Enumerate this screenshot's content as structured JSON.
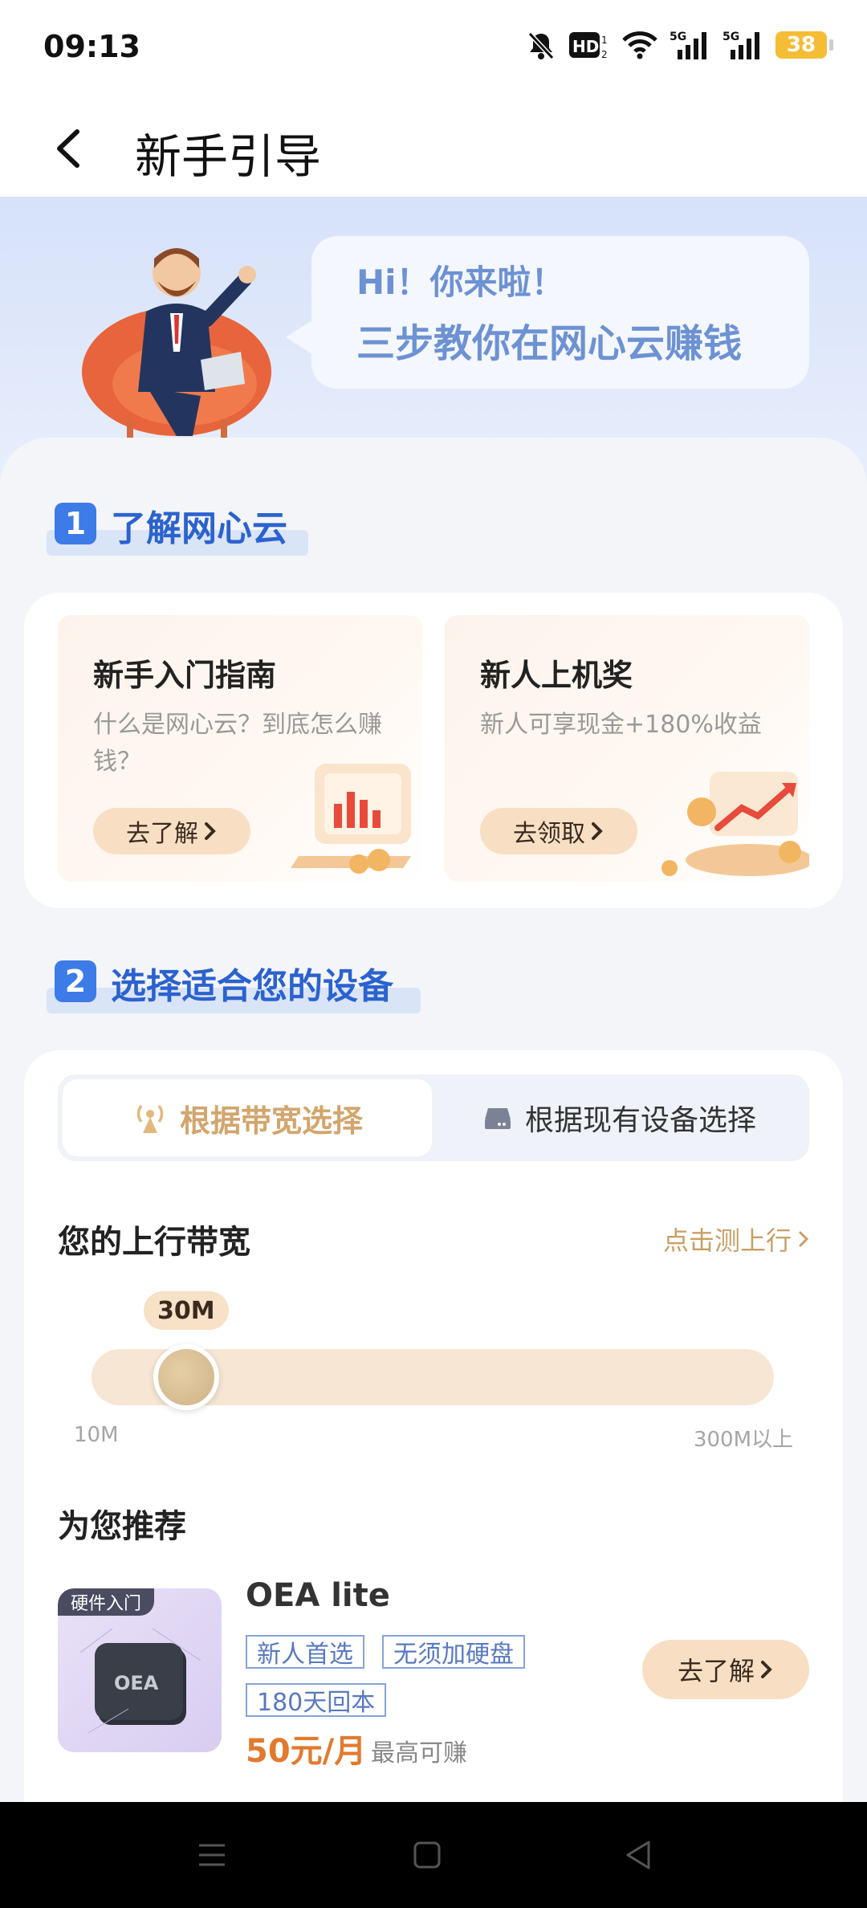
{
  "status_bar": {
    "time": "09:13",
    "battery": "38"
  },
  "header": {
    "title": "新手引导"
  },
  "banner": {
    "greeting": "Hi！你来啦！",
    "subtitle": "三步教你在网心云赚钱"
  },
  "section1": {
    "number": "1",
    "title": "了解网心云",
    "cards": [
      {
        "title": "新手入门指南",
        "desc": "什么是网心云？到底怎么赚钱？",
        "button": "去了解"
      },
      {
        "title": "新人上机奖",
        "desc": "新人可享现金+180%收益",
        "button": "去领取"
      }
    ]
  },
  "section2": {
    "number": "2",
    "title": "选择适合您的设备",
    "tabs": [
      {
        "label": "根据带宽选择",
        "active": true
      },
      {
        "label": "根据现有设备选择",
        "active": false
      }
    ],
    "bandwidth": {
      "label": "您的上行带宽",
      "test_link": "点击测上行",
      "value": "30M",
      "min_label": "10M",
      "max_label": "300M以上",
      "level_fraction": 0.1
    },
    "recommend": {
      "title": "为您推荐",
      "product": {
        "badge": "硬件入门",
        "name": "OEA lite",
        "tags": [
          "新人首选",
          "无须加硬盘",
          "180天回本"
        ],
        "price": "50元/月",
        "price_note": "最高可赚",
        "button": "去了解"
      }
    }
  },
  "colors": {
    "accent_blue": "#3c7be8",
    "gold": "#c8a064",
    "price_orange": "#e27a2e"
  }
}
